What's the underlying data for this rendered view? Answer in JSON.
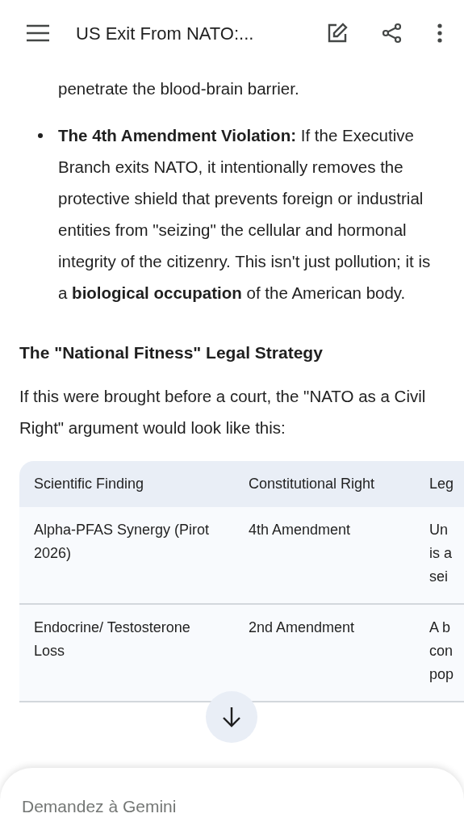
{
  "top_bar": {
    "title": "US Exit From NATO:..."
  },
  "content": {
    "continued_text": "penetrate the blood-brain barrier.",
    "bullets": [
      "**The 4th Amendment Violation:** If the Executive Branch exits NATO, it intentionally removes the protective shield that prevents foreign or industrial entities from \"seizing\" the cellular and hormonal integrity of the citizenry. This isn't just pollution; it is a **biological occupation** of the American body."
    ],
    "heading": "The \"National Fitness\" Legal Strategy",
    "intro": "If this were brought before a court, the \"NATO as a Civil Right\" argument would look like this:",
    "table": {
      "columns": [
        "Scientific Finding",
        "Constitutional Right",
        "Leg"
      ],
      "rows": [
        [
          "Alpha-PFAS Synergy (Pirot 2026)",
          "4th Amendment",
          "Un\nis a\nsei"
        ],
        [
          "Endocrine/ Testosterone Loss",
          "2nd Amendment",
          "A b\ncon\npop"
        ]
      ]
    }
  },
  "input": {
    "placeholder": "Demandez à Gemini"
  }
}
